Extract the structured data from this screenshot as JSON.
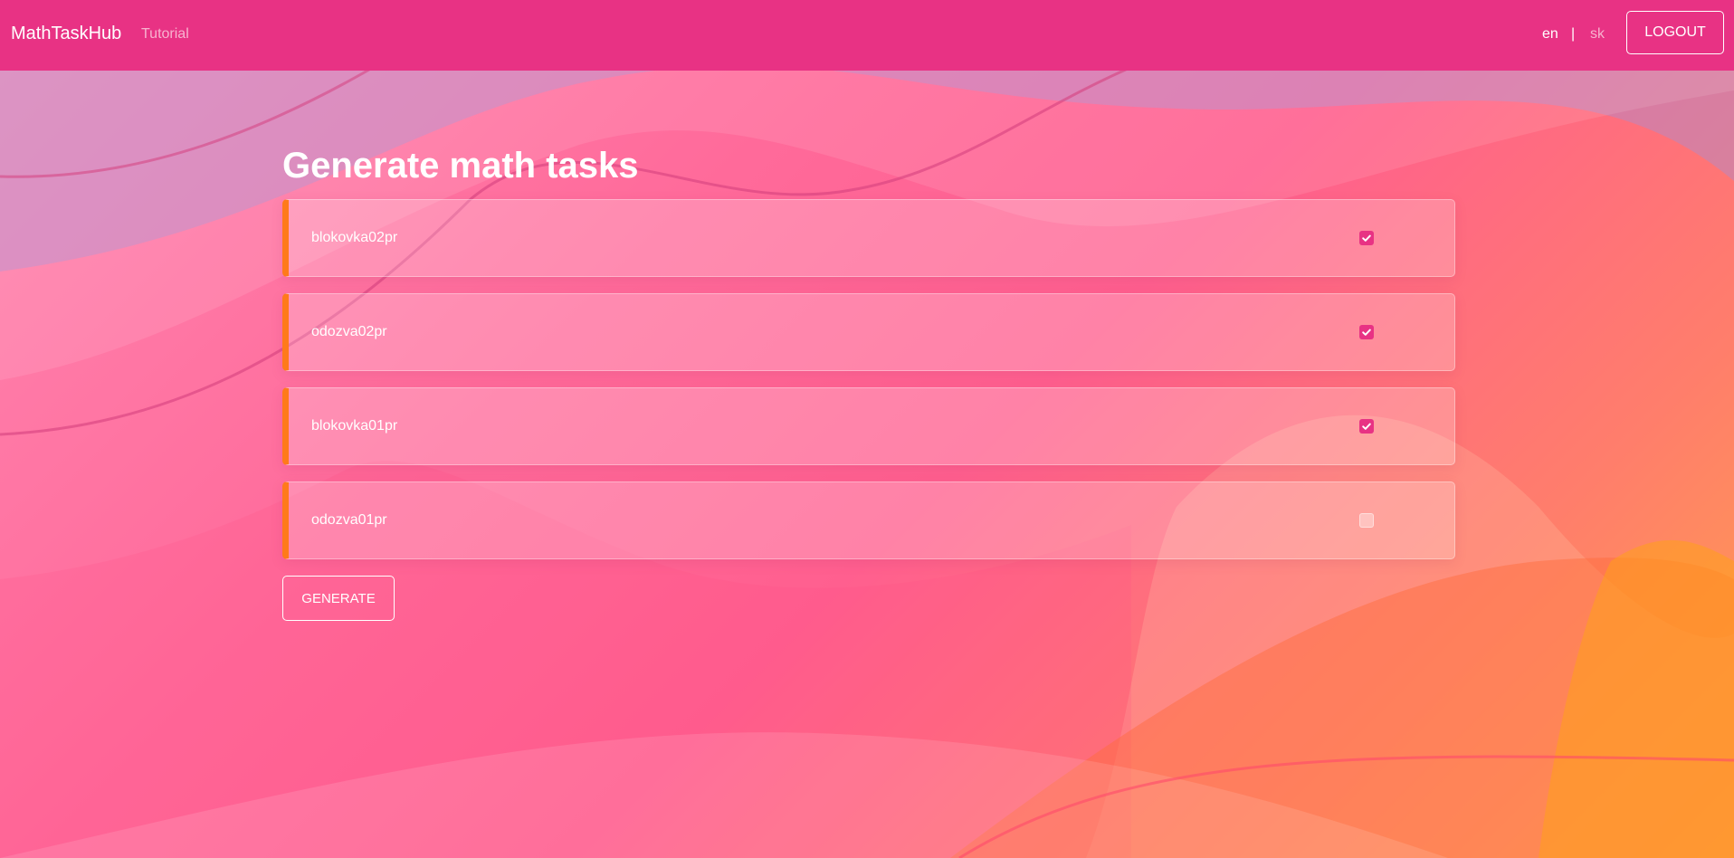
{
  "navbar": {
    "brand": "MathTaskHub",
    "tutorial_label": "Tutorial",
    "languages": [
      {
        "code": "en",
        "active": true
      },
      {
        "code": "sk",
        "active": false
      }
    ],
    "separator": "|",
    "logout_label": "LOGOUT",
    "background_color": "#e83284"
  },
  "main": {
    "title": "Generate math tasks",
    "tasks": [
      {
        "label": "blokovka02pr",
        "checked": true
      },
      {
        "label": "odozva02pr",
        "checked": true
      },
      {
        "label": "blokovka01pr",
        "checked": true
      },
      {
        "label": "odozva01pr",
        "checked": false
      }
    ],
    "generate_label": "GENERATE"
  },
  "colors": {
    "accent_border": "#ff7a1a",
    "checkbox_checked": "#e83284"
  },
  "icons": {
    "checkbox_checked": "checkmark-icon"
  }
}
